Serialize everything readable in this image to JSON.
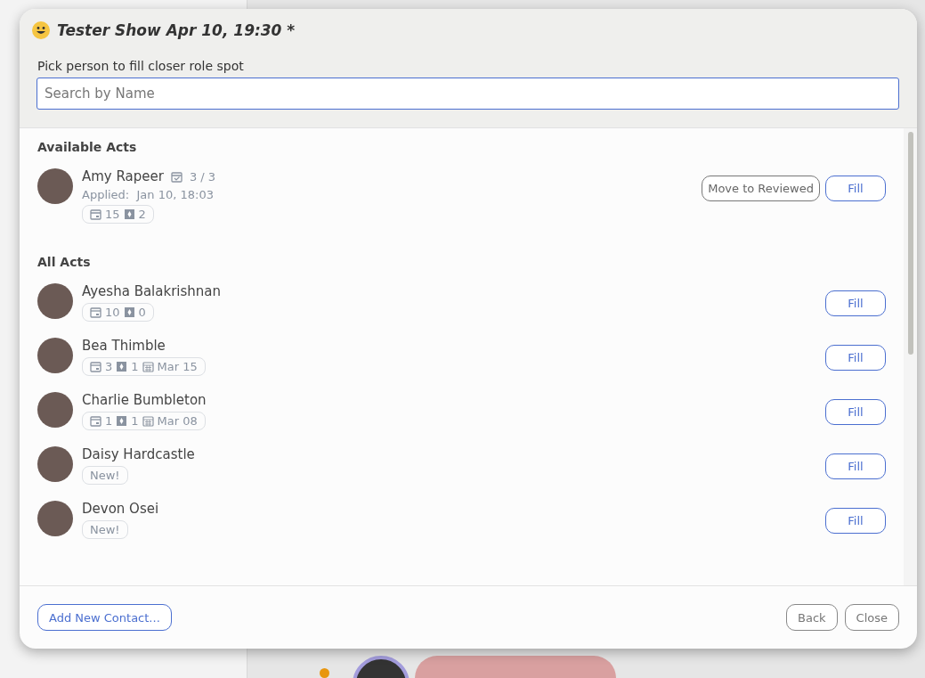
{
  "dialog": {
    "title": "Tester Show Apr 10, 19:30 *",
    "prompt": "Pick person to fill closer role spot",
    "search": {
      "placeholder": "Search by Name"
    }
  },
  "sections": [
    {
      "title": "Available Acts",
      "people": [
        {
          "name": "Amy Rapeer",
          "spots": "3 / 3",
          "applied_label": "Applied:",
          "applied": "Jan 10, 18:03",
          "stats": [
            {
              "kind": "shows",
              "text": "15"
            },
            {
              "kind": "spots",
              "text": "2"
            }
          ],
          "actions": [
            {
              "label": "Move to Reviewed",
              "kind": "neutral"
            },
            {
              "label": "Fill",
              "kind": "primary"
            }
          ]
        }
      ]
    },
    {
      "title": "All Acts",
      "people": [
        {
          "name": "Ayesha Balakrishnan",
          "stats": [
            {
              "kind": "shows",
              "text": "10"
            },
            {
              "kind": "spots",
              "text": "0"
            }
          ],
          "actions": [
            {
              "label": "Fill",
              "kind": "primary"
            }
          ]
        },
        {
          "name": "Bea Thimble",
          "stats": [
            {
              "kind": "shows",
              "text": "3"
            },
            {
              "kind": "spots",
              "text": "1"
            },
            {
              "kind": "date",
              "text": "Mar 15"
            }
          ],
          "actions": [
            {
              "label": "Fill",
              "kind": "primary"
            }
          ]
        },
        {
          "name": "Charlie Bumbleton",
          "stats": [
            {
              "kind": "shows",
              "text": "1"
            },
            {
              "kind": "spots",
              "text": "1"
            },
            {
              "kind": "date",
              "text": "Mar 08"
            }
          ],
          "actions": [
            {
              "label": "Fill",
              "kind": "primary"
            }
          ]
        },
        {
          "name": "Daisy Hardcastle",
          "stats": [
            {
              "kind": "new",
              "text": "New!"
            }
          ],
          "actions": [
            {
              "label": "Fill",
              "kind": "primary"
            }
          ]
        },
        {
          "name": "Devon Osei",
          "stats": [
            {
              "kind": "new",
              "text": "New!"
            }
          ],
          "actions": [
            {
              "label": "Fill",
              "kind": "primary"
            }
          ]
        }
      ]
    }
  ],
  "footer": {
    "left": "Add New Contact...",
    "right": [
      "Back",
      "Close"
    ]
  }
}
